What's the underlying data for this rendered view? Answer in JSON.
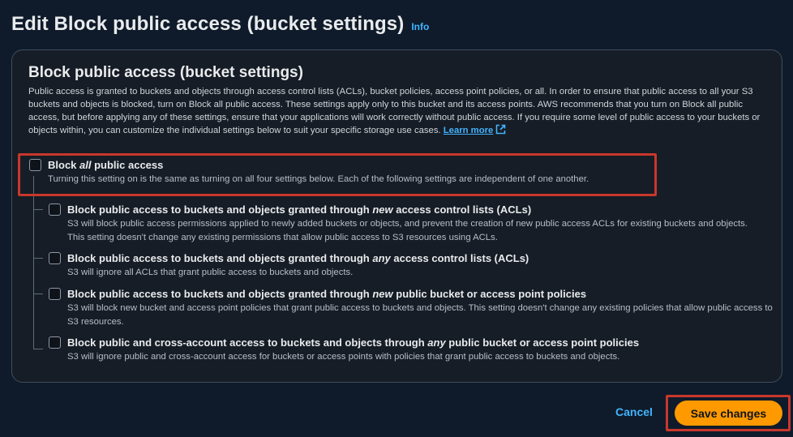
{
  "header": {
    "title": "Edit Block public access (bucket settings)",
    "info_link": "Info"
  },
  "panel": {
    "title": "Block public access (bucket settings)",
    "description": "Public access is granted to buckets and objects through access control lists (ACLs), bucket policies, access point policies, or all. In order to ensure that public access to all your S3 buckets and objects is blocked, turn on Block all public access. These settings apply only to this bucket and its access points. AWS recommends that you turn on Block all public access, but before applying any of these settings, ensure that your applications will work correctly without public access. If you require some level of public access to your buckets or objects within, you can customize the individual settings below to suit your specific storage use cases.",
    "learn_more": "Learn more",
    "block_all": {
      "label_pre": "Block ",
      "label_em": "all",
      "label_post": " public access",
      "description": "Turning this setting on is the same as turning on all four settings below. Each of the following settings are independent of one another.",
      "checked": false
    },
    "options": [
      {
        "label_pre": "Block public access to buckets and objects granted through ",
        "label_em": "new",
        "label_post": " access control lists (ACLs)",
        "description": "S3 will block public access permissions applied to newly added buckets or objects, and prevent the creation of new public access ACLs for existing buckets and objects. This setting doesn't change any existing permissions that allow public access to S3 resources using ACLs.",
        "checked": false
      },
      {
        "label_pre": "Block public access to buckets and objects granted through ",
        "label_em": "any",
        "label_post": " access control lists (ACLs)",
        "description": "S3 will ignore all ACLs that grant public access to buckets and objects.",
        "checked": false
      },
      {
        "label_pre": "Block public access to buckets and objects granted through ",
        "label_em": "new",
        "label_post": " public bucket or access point policies",
        "description": "S3 will block new bucket and access point policies that grant public access to buckets and objects. This setting doesn't change any existing policies that allow public access to S3 resources.",
        "checked": false
      },
      {
        "label_pre": "Block public and cross-account access to buckets and objects through ",
        "label_em": "any",
        "label_post": " public bucket or access point policies",
        "description": "S3 will ignore public and cross-account access for buckets or access points with policies that grant public access to buckets and objects.",
        "checked": false
      }
    ]
  },
  "footer": {
    "cancel_label": "Cancel",
    "save_label": "Save changes"
  },
  "colors": {
    "accent_link": "#42b4ff",
    "primary_button": "#ff9900",
    "highlight": "#c9372c"
  }
}
